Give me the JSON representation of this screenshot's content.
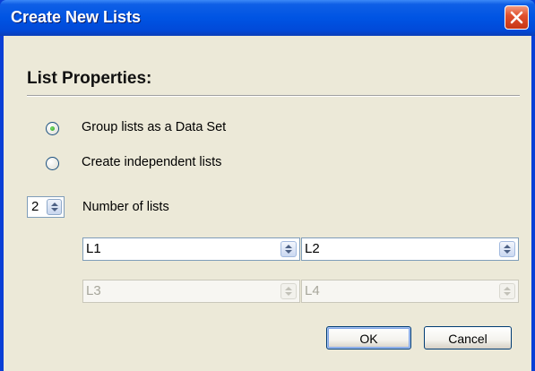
{
  "dialog": {
    "title": "Create New Lists",
    "close_icon": "close-icon"
  },
  "properties": {
    "heading": "List Properties:",
    "options": [
      {
        "label": "Group lists as a Data Set",
        "selected": true
      },
      {
        "label": "Create independent lists",
        "selected": false
      }
    ],
    "number_of_lists": {
      "value": "2",
      "label": "Number of lists"
    }
  },
  "lists": [
    {
      "value": "L1",
      "enabled": true
    },
    {
      "value": "L2",
      "enabled": true
    },
    {
      "value": "L3",
      "enabled": false
    },
    {
      "value": "L4",
      "enabled": false
    }
  ],
  "buttons": {
    "ok": "OK",
    "cancel": "Cancel"
  },
  "colors": {
    "title_bar": "#0054e3",
    "client_bg": "#ece9d8",
    "close_button": "#e1512f",
    "radio_selected": "#21a121"
  }
}
